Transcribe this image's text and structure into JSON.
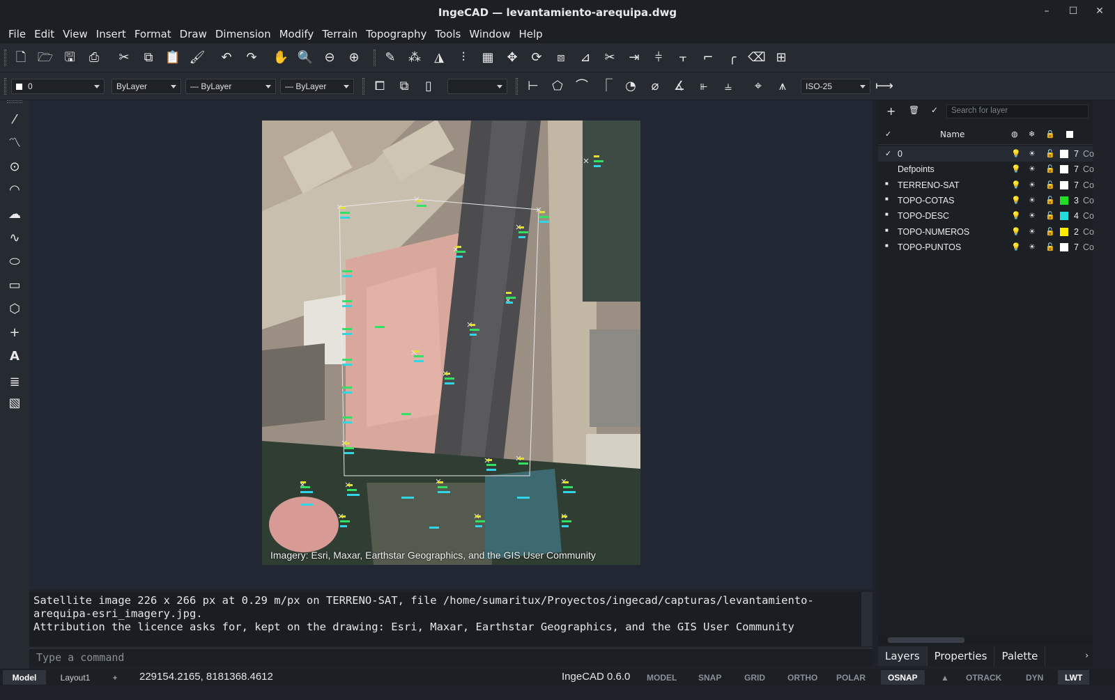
{
  "window": {
    "title": "IngeCAD — levantamiento-arequipa.dwg",
    "minimize": "–",
    "maximize": "☐",
    "close": "✕"
  },
  "menu": [
    "File",
    "Edit",
    "View",
    "Insert",
    "Format",
    "Draw",
    "Dimension",
    "Modify",
    "Terrain",
    "Topography",
    "Tools",
    "Window",
    "Help"
  ],
  "props_bar": {
    "layer": "0",
    "color": "ByLayer",
    "linetype": "— ByLayer",
    "lineweight": "— ByLayer",
    "blank_combo": "",
    "dim_style": "ISO-25"
  },
  "drawing": {
    "attribution_overlay": "Imagery: Esri, Maxar, Earthstar Geographics, and the GIS User Community"
  },
  "command": {
    "output_lines": [
      "Satellite image 226 x 266 px at 0.29 m/px on TERRENO-SAT, file /home/sumaritux/Proyectos/ingecad/capturas/levantamiento-arequipa-esri_imagery.jpg.",
      "Attribution the licence asks for, kept on the drawing: Esri, Maxar, Earthstar Geographics, and the GIS User Community"
    ],
    "placeholder": "Type a command"
  },
  "layers_panel": {
    "search_placeholder": "Search for layer",
    "header_name": "Name",
    "layers": [
      {
        "name": "0",
        "current": true,
        "color": "#ffffff",
        "color_num": "7",
        "color_label": "Co"
      },
      {
        "name": "Defpoints",
        "current": false,
        "color": "#ffffff",
        "color_num": "7",
        "color_label": "Co"
      },
      {
        "name": "TERRENO-SAT",
        "current": false,
        "color": "#ffffff",
        "color_num": "7",
        "color_label": "Co"
      },
      {
        "name": "TOPO-COTAS",
        "current": false,
        "color": "#22dd22",
        "color_num": "3",
        "color_label": "Co"
      },
      {
        "name": "TOPO-DESC",
        "current": false,
        "color": "#22dddd",
        "color_num": "4",
        "color_label": "Co"
      },
      {
        "name": "TOPO-NUMEROS",
        "current": false,
        "color": "#ffee00",
        "color_num": "2",
        "color_label": "Co"
      },
      {
        "name": "TOPO-PUNTOS",
        "current": false,
        "color": "#ffffff",
        "color_num": "7",
        "color_label": "Co"
      }
    ],
    "tabs": [
      "Layers",
      "Properties",
      "Palette"
    ]
  },
  "status": {
    "tabs": {
      "model": "Model",
      "layout": "Layout1",
      "add": "+"
    },
    "coords": "229154.2165, 8181368.4612",
    "version": "IngeCAD 0.6.0",
    "toggles": [
      {
        "label": "MODEL",
        "on": false
      },
      {
        "label": "SNAP",
        "on": false
      },
      {
        "label": "GRID",
        "on": false
      },
      {
        "label": "ORTHO",
        "on": false
      },
      {
        "label": "POLAR",
        "on": false
      },
      {
        "label": "OSNAP",
        "on": true
      },
      {
        "label": "▲",
        "on": false
      },
      {
        "label": "OTRACK",
        "on": false
      },
      {
        "label": "DYN",
        "on": false
      },
      {
        "label": "LWT",
        "on": true
      }
    ]
  }
}
